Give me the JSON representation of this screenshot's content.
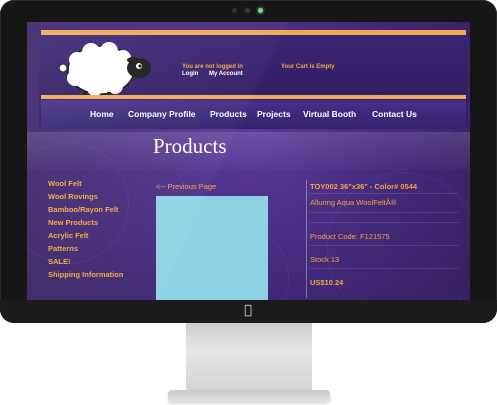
{
  "header": {
    "login_status": "You are not logged in",
    "login_link": "Login",
    "account_link": "My Account",
    "cart_status": "Your Cart Is Empty"
  },
  "nav": {
    "items": [
      "Home",
      "Company Profile",
      "Products",
      "Projects",
      "Virtual Booth",
      "Contact Us"
    ]
  },
  "page_title": "Products",
  "sidebar": {
    "items": [
      "Wool Felt",
      "Wool Rovings",
      "Bamboo/Rayon Felt",
      "New Products",
      "Acrylic Felt",
      "Patterns",
      "SALE!",
      "Shipping Information"
    ]
  },
  "product": {
    "prev_link": "<-- Previous Page",
    "code_line": "TOY002 36\"x36\" - Color# 0544",
    "name": "Alluring Aqua WoolFeltÂ®",
    "product_code": "Product Code: F121575",
    "stock": "Stock 13",
    "price": "US$10.24",
    "swatch_color": "#8fd2e3"
  },
  "colors": {
    "accent": "#f3a640",
    "background": "#43297a",
    "stripe": "#f1a957"
  },
  "icons": {
    "logo": "sheep-logo",
    "apple": "apple-logo-icon"
  }
}
